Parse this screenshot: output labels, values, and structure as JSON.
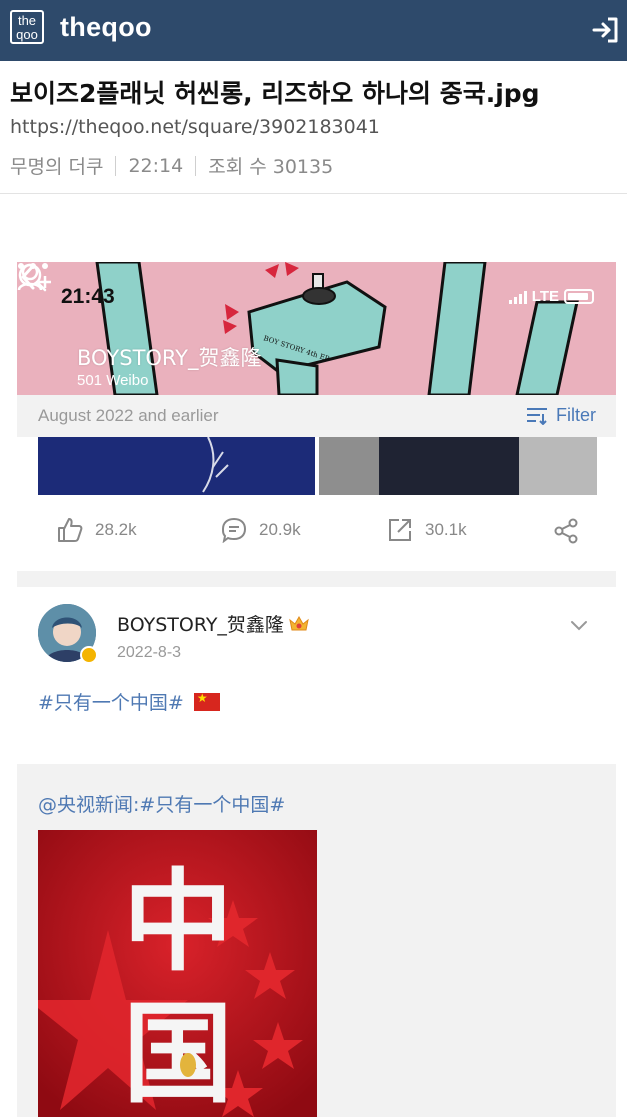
{
  "app": {
    "logo_line1": "the",
    "logo_line2": "qoo",
    "brand": "theqoo",
    "login_icon": "login-arrow-icon"
  },
  "post": {
    "title": "보이즈2플래닛 허씬롱, 리즈하오 하나의 중국.jpg",
    "url": "https://theqoo.net/square/3902183041",
    "author": "무명의 더쿠",
    "time": "22:14",
    "views_label": "조회 수 30135"
  },
  "screenshot": {
    "status_time": "21:43",
    "network": "LTE",
    "profile_name": "BOYSTORY_贺鑫隆",
    "profile_count": "501 Weibo",
    "banner_text": "BOY STORY 4th EP",
    "filter_date": "August 2022 and earlier",
    "filter_label": "Filter",
    "actions": {
      "like": "28.2k",
      "comment": "20.9k",
      "share": "30.1k"
    },
    "weibo": {
      "author": "BOYSTORY_贺鑫隆",
      "date": "2022-8-3",
      "hashtag": "#只有一个中国#",
      "repost_text": "@央视新闻:#只有一个中国#",
      "poster_text": "中国"
    }
  },
  "colors": {
    "topbar": "#2e4a6b",
    "banner_pink": "#eab1bd",
    "link_blue": "#4f79b3",
    "poster_red": "#c3121c"
  }
}
